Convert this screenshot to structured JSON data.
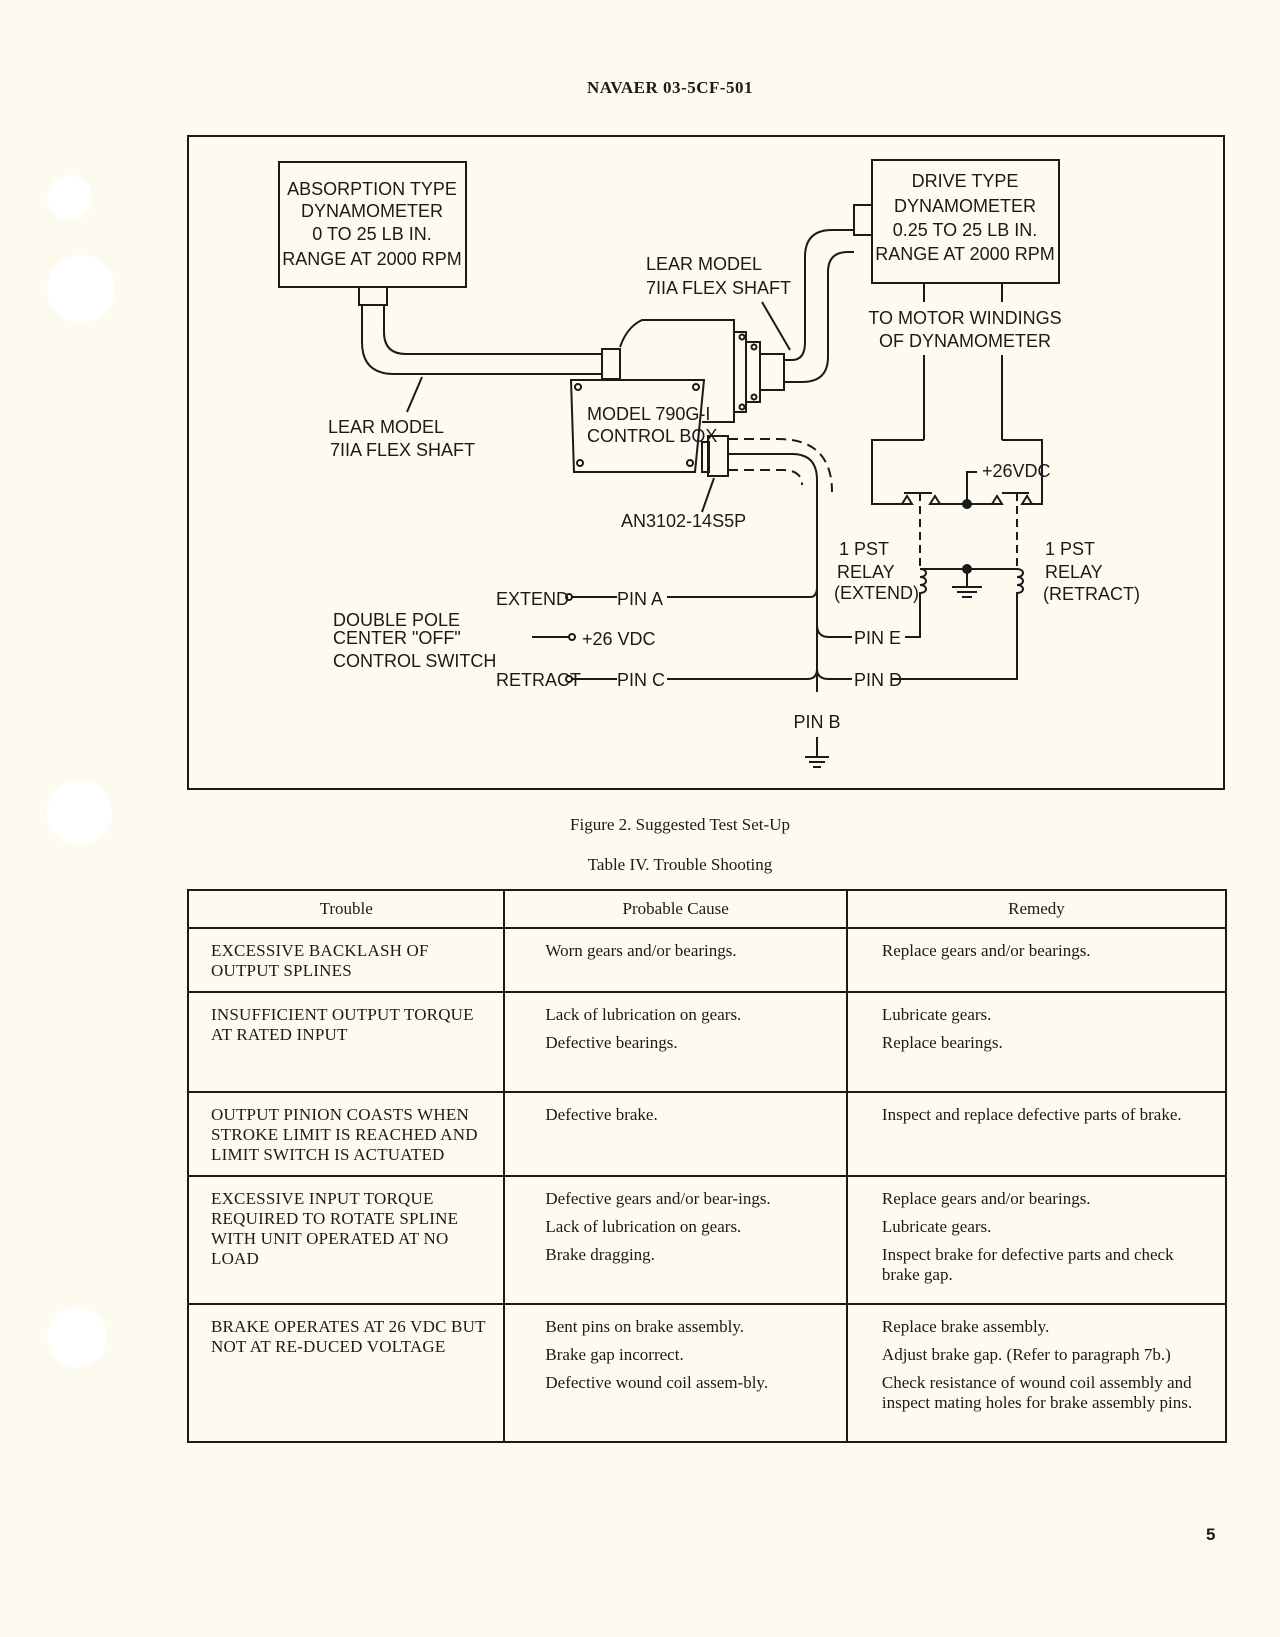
{
  "header": {
    "doc_id": "NAVAER 03-5CF-501"
  },
  "figure": {
    "caption": "Figure 2.  Suggested Test Set-Up",
    "absorption_dyno": [
      "ABSORPTION  TYPE",
      "DYNAMOMETER",
      "0 TO  25 LB  IN.",
      "RANGE  AT 2000 RPM"
    ],
    "drive_dyno": [
      "DRIVE TYPE",
      "DYNAMOMETER",
      "0.25  TO 25 LB  IN.",
      "RANGE AT 2000 RPM"
    ],
    "flex_shaft_left": [
      "LEAR  MODEL",
      "7IIA  FLEX  SHAFT"
    ],
    "flex_shaft_right": [
      "LEAR  MODEL",
      "7IIA  FLEX  SHAFT"
    ],
    "control_box": [
      "MODEL  790G-I",
      "CONTROL  BOX"
    ],
    "connector": "AN3102-14S5P",
    "motor_windings": [
      "TO  MOTOR  WINDINGS",
      "OF  DYNAMOMETER"
    ],
    "supply_relays": "+26VDC",
    "relay_extend": [
      "1 PST",
      "RELAY",
      "(EXTEND)"
    ],
    "relay_retract": [
      "1 PST",
      "RELAY",
      "(RETRACT)"
    ],
    "switch_label": [
      "DOUBLE  POLE",
      "CENTER  \"OFF\"",
      "CONTROL  SWITCH"
    ],
    "switch_extend": "EXTEND",
    "switch_retract": "RETRACT",
    "switch_supply": "+26 VDC",
    "pin_a": "PIN A",
    "pin_b": "PIN  B",
    "pin_c": "PIN  C",
    "pin_d": "PIN  D",
    "pin_e": "PIN  E"
  },
  "table": {
    "caption": "Table IV.  Trouble Shooting",
    "headers": [
      "Trouble",
      "Probable Cause",
      "Remedy"
    ],
    "rows": [
      {
        "trouble": "EXCESSIVE BACKLASH OF OUTPUT SPLINES",
        "causes": [
          "Worn gears and/or bearings."
        ],
        "remedies": [
          "Replace gears and/or bearings."
        ]
      },
      {
        "trouble": "INSUFFICIENT OUTPUT TORQUE AT RATED INPUT",
        "causes": [
          "Lack of lubrication on gears.",
          "Defective bearings."
        ],
        "remedies": [
          "Lubricate gears.",
          "Replace bearings."
        ]
      },
      {
        "trouble": "OUTPUT PINION COASTS WHEN STROKE LIMIT IS REACHED AND LIMIT SWITCH IS ACTUATED",
        "causes": [
          "Defective brake."
        ],
        "remedies": [
          "Inspect and replace defective parts of brake."
        ]
      },
      {
        "trouble": "EXCESSIVE INPUT TORQUE REQUIRED TO ROTATE SPLINE WITH UNIT OPERATED AT NO LOAD",
        "causes": [
          "Defective gears and/or bear-ings.",
          "Lack of lubrication on gears.",
          "Brake dragging."
        ],
        "remedies": [
          "Replace gears and/or bearings.",
          "Lubricate gears.",
          "Inspect brake for defective parts and check brake gap."
        ]
      },
      {
        "trouble": "BRAKE OPERATES AT 26 VDC BUT NOT AT RE-DUCED VOLTAGE",
        "causes": [
          "Bent pins on brake assembly.",
          "Brake gap incorrect.",
          "Defective wound coil assem-bly."
        ],
        "remedies": [
          "Replace brake assembly.",
          "Adjust brake gap.  (Refer to paragraph 7b.)",
          "Check resistance of wound coil assembly and inspect mating holes for brake assembly pins."
        ]
      }
    ]
  },
  "footer": {
    "page_number": "5"
  }
}
